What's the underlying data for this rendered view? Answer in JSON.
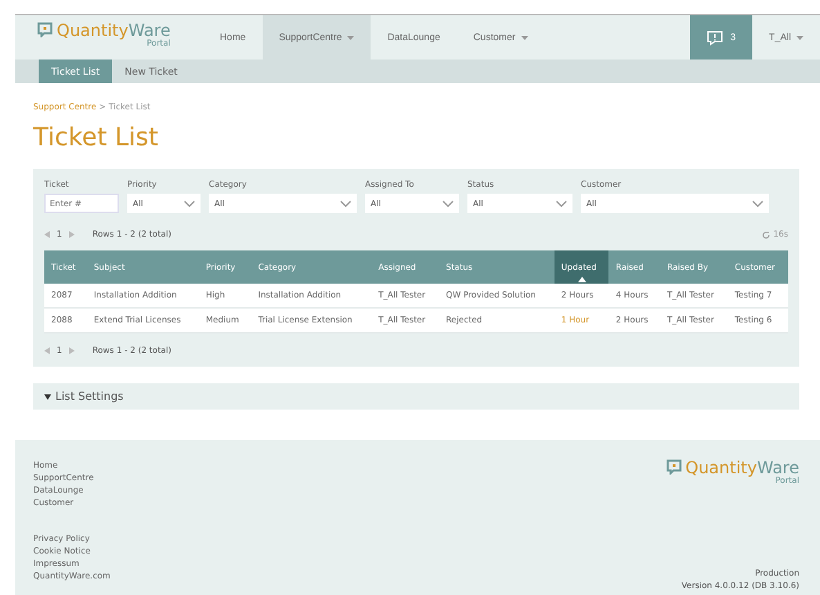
{
  "brand": {
    "name_a": "Quantity",
    "name_b": "Ware",
    "sub": "Portal"
  },
  "nav": [
    {
      "label": "Home",
      "selected": false,
      "dropdown": false
    },
    {
      "label": "SupportCentre",
      "selected": true,
      "dropdown": true
    },
    {
      "label": "DataLounge",
      "selected": false,
      "dropdown": false
    },
    {
      "label": "Customer",
      "selected": false,
      "dropdown": true
    }
  ],
  "notifications": {
    "count": "3"
  },
  "user": {
    "label": "T_All"
  },
  "subnav": [
    {
      "label": "Ticket List",
      "selected": true
    },
    {
      "label": "New Ticket",
      "selected": false
    }
  ],
  "breadcrumb": {
    "parent": "Support Centre",
    "separator": ">",
    "current": "Ticket List"
  },
  "title": "Ticket List",
  "filters": [
    {
      "label": "Ticket",
      "kind": "input",
      "placeholder": "Enter #"
    },
    {
      "label": "Priority",
      "kind": "select",
      "value": "All"
    },
    {
      "label": "Category",
      "kind": "select",
      "value": "All"
    },
    {
      "label": "Assigned To",
      "kind": "select",
      "value": "All"
    },
    {
      "label": "Status",
      "kind": "select",
      "value": "All"
    },
    {
      "label": "Customer",
      "kind": "select",
      "value": "All"
    }
  ],
  "pager_top": {
    "page": "1",
    "rows": "Rows 1 - 2 (2 total)",
    "refresh": "16s"
  },
  "table": {
    "columns": [
      {
        "label": "Ticket",
        "sorted": false
      },
      {
        "label": "Subject",
        "sorted": false
      },
      {
        "label": "Priority",
        "sorted": false
      },
      {
        "label": "Category",
        "sorted": false
      },
      {
        "label": "Assigned",
        "sorted": false
      },
      {
        "label": "Status",
        "sorted": false
      },
      {
        "label": "Updated",
        "sorted": true
      },
      {
        "label": "Raised",
        "sorted": false
      },
      {
        "label": "Raised By",
        "sorted": false
      },
      {
        "label": "Customer",
        "sorted": false
      }
    ],
    "rows": [
      {
        "cells": [
          "2087",
          "Installation Addition",
          "High",
          "Installation Addition",
          "T_All Tester",
          "QW Provided Solution",
          "2 Hours",
          "4 Hours",
          "T_All Tester",
          "Testing 7"
        ],
        "recent": false
      },
      {
        "cells": [
          "2088",
          "Extend Trial Licenses",
          "Medium",
          "Trial License Extension",
          "T_All Tester",
          "Rejected",
          "1 Hour",
          "2 Hours",
          "T_All Tester",
          "Testing 6"
        ],
        "recent": true
      }
    ]
  },
  "pager_bottom": {
    "page": "1",
    "rows": "Rows 1 - 2 (2 total)"
  },
  "list_settings": {
    "label": "List Settings",
    "expanded": false
  },
  "footer": {
    "brand": {
      "name_a": "Quantity",
      "name_b": "Ware",
      "sub": "Portal"
    },
    "links": [
      "Home",
      "SupportCentre",
      "DataLounge",
      "Customer"
    ],
    "legal": [
      "Privacy Policy",
      "Cookie Notice",
      "Impressum",
      "QuantityWare.com"
    ],
    "environment": "Production",
    "version": "Version 4.0.0.12 (DB 3.10.6)"
  }
}
